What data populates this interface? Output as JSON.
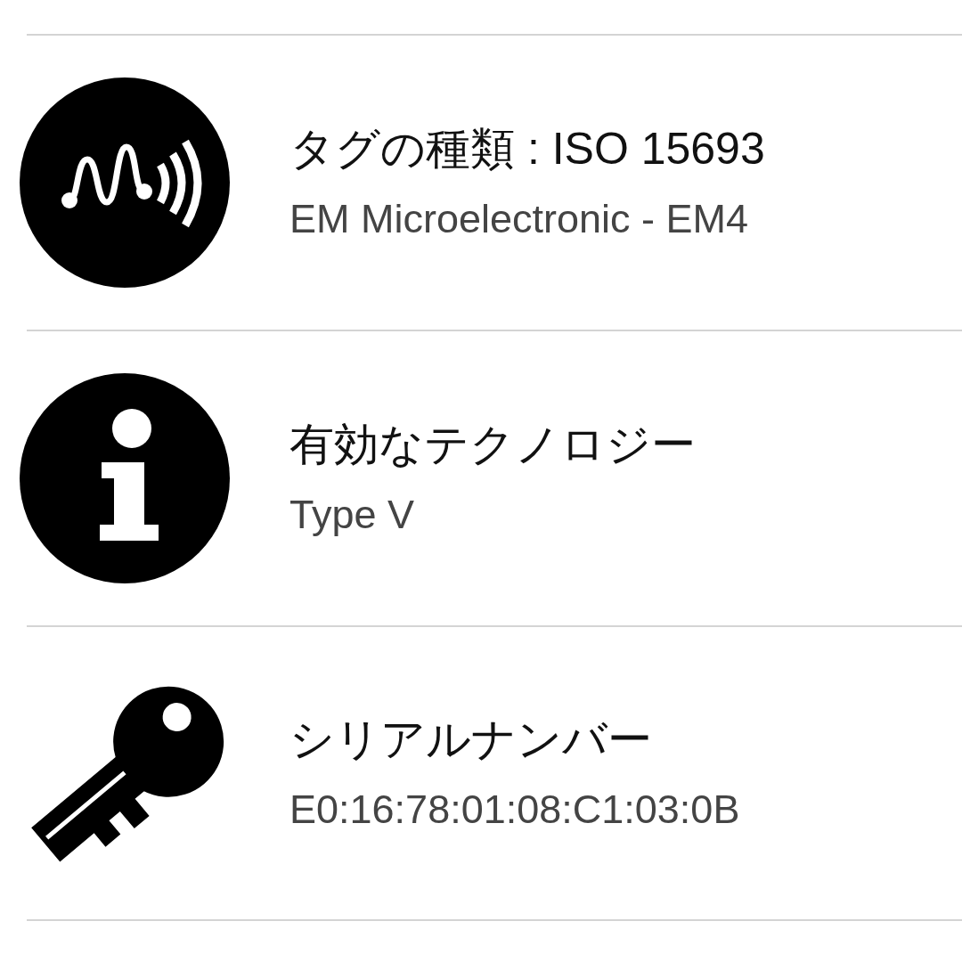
{
  "rows": [
    {
      "kind": "nfc",
      "title": "タグの種類 : ISO 15693",
      "value": "EM Microelectronic - EM4"
    },
    {
      "kind": "info",
      "title": "有効なテクノロジー",
      "value": "Type V"
    },
    {
      "kind": "key",
      "title": "シリアルナンバー",
      "value": "E0:16:78:01:08:C1:03:0B"
    }
  ]
}
